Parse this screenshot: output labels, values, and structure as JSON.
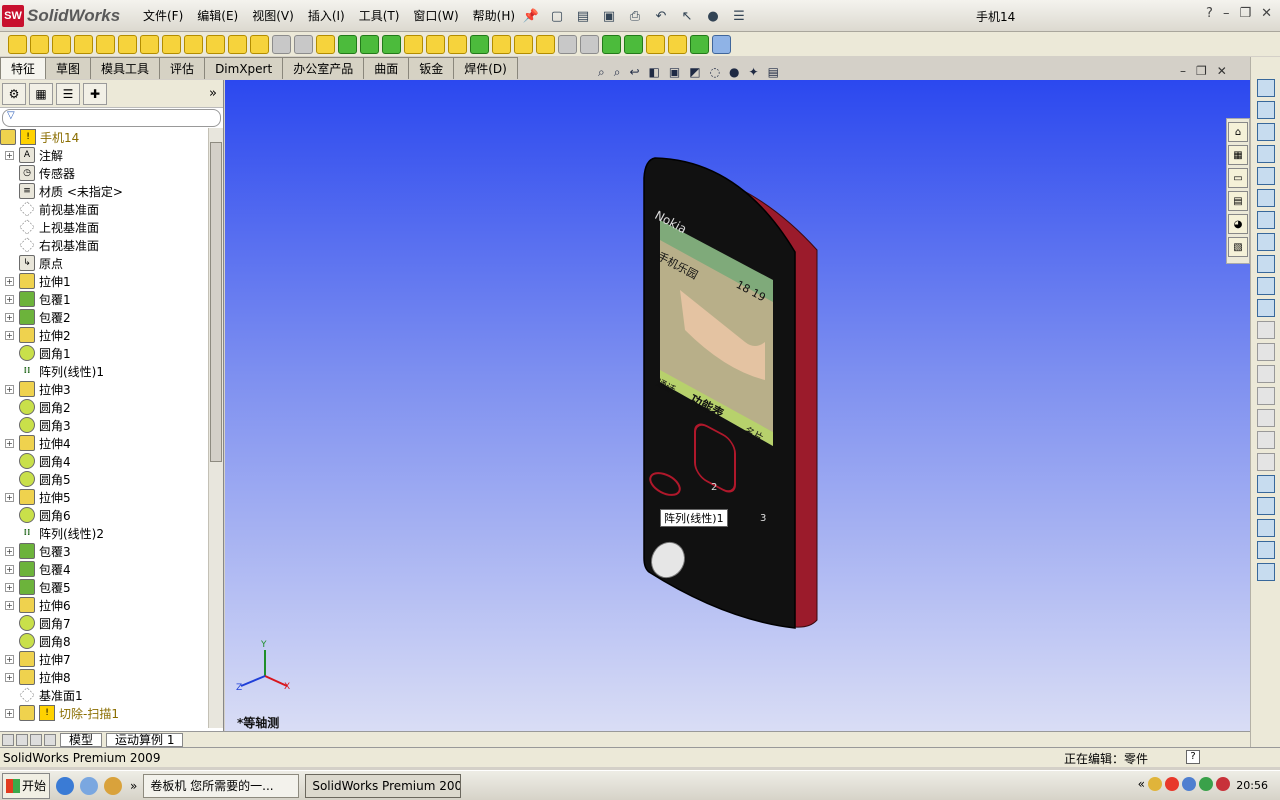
{
  "app": {
    "brand": "SolidWorks",
    "logo_mark": "SW",
    "doc_title": "手机14"
  },
  "menu": [
    "文件(F)",
    "编辑(E)",
    "视图(V)",
    "插入(I)",
    "工具(T)",
    "窗口(W)",
    "帮助(H)"
  ],
  "window_controls": [
    "?",
    "–",
    "❐",
    "✕"
  ],
  "tabs": [
    "特征",
    "草图",
    "模具工具",
    "评估",
    "DimXpert",
    "办公室产品",
    "曲面",
    "钣金",
    "焊件(D)"
  ],
  "active_tab": 0,
  "feature_tree": {
    "filter_placeholder": "",
    "root": {
      "label": "手机14",
      "warning": true
    },
    "items": [
      {
        "label": "注解",
        "icon": "annotation-icon",
        "expandable": true
      },
      {
        "label": "传感器",
        "icon": "sensor-icon",
        "expandable": false
      },
      {
        "label": "材质 <未指定>",
        "icon": "material-icon",
        "expandable": false
      },
      {
        "label": "前视基准面",
        "icon": "plane-icon",
        "expandable": false
      },
      {
        "label": "上视基准面",
        "icon": "plane-icon",
        "expandable": false
      },
      {
        "label": "右视基准面",
        "icon": "plane-icon",
        "expandable": false
      },
      {
        "label": "原点",
        "icon": "origin-icon",
        "expandable": false
      },
      {
        "label": "拉伸1",
        "icon": "extrude-icon",
        "expandable": true
      },
      {
        "label": "包覆1",
        "icon": "wrap-icon",
        "expandable": true
      },
      {
        "label": "包覆2",
        "icon": "wrap-icon",
        "expandable": true
      },
      {
        "label": "拉伸2",
        "icon": "extrude-icon",
        "expandable": true
      },
      {
        "label": "圆角1",
        "icon": "fillet-icon",
        "expandable": false
      },
      {
        "label": "阵列(线性)1",
        "icon": "linear-pattern-icon",
        "expandable": false
      },
      {
        "label": "拉伸3",
        "icon": "extrude-icon",
        "expandable": true
      },
      {
        "label": "圆角2",
        "icon": "fillet-icon",
        "expandable": false
      },
      {
        "label": "圆角3",
        "icon": "fillet-icon",
        "expandable": false
      },
      {
        "label": "拉伸4",
        "icon": "extrude-icon",
        "expandable": true
      },
      {
        "label": "圆角4",
        "icon": "fillet-icon",
        "expandable": false
      },
      {
        "label": "圆角5",
        "icon": "fillet-icon",
        "expandable": false
      },
      {
        "label": "拉伸5",
        "icon": "extrude-icon",
        "expandable": true
      },
      {
        "label": "圆角6",
        "icon": "fillet-icon",
        "expandable": false
      },
      {
        "label": "阵列(线性)2",
        "icon": "linear-pattern-icon",
        "expandable": false
      },
      {
        "label": "包覆3",
        "icon": "wrap-icon",
        "expandable": true
      },
      {
        "label": "包覆4",
        "icon": "wrap-icon",
        "expandable": true
      },
      {
        "label": "包覆5",
        "icon": "wrap-icon",
        "expandable": true
      },
      {
        "label": "拉伸6",
        "icon": "extrude-icon",
        "expandable": true
      },
      {
        "label": "圆角7",
        "icon": "fillet-icon",
        "expandable": false
      },
      {
        "label": "圆角8",
        "icon": "fillet-icon",
        "expandable": false
      },
      {
        "label": "拉伸7",
        "icon": "extrude-icon",
        "expandable": true
      },
      {
        "label": "拉伸8",
        "icon": "extrude-icon",
        "expandable": true
      },
      {
        "label": "基准面1",
        "icon": "plane-icon",
        "expandable": false
      },
      {
        "label": "切除-扫描1",
        "icon": "cut-sweep-icon",
        "expandable": true,
        "warning": true
      }
    ]
  },
  "bottom_tabs": [
    "模型",
    "运动算例 1"
  ],
  "viewport": {
    "view_name": "*等轴测",
    "tooltip": "阵列(线性)1",
    "triad": {
      "x": "X",
      "y": "Y",
      "z": "Z"
    },
    "phone_screen": {
      "brand": "Nokia",
      "header_left": "手机乐园",
      "clock": "18 19",
      "softkey_left": "通话",
      "softkey_center": "功能表",
      "softkey_right": "名片",
      "keys": [
        "2",
        "3"
      ]
    }
  },
  "status": {
    "left": "SolidWorks Premium 2009",
    "editing": "正在编辑：零件",
    "help": "?"
  },
  "taskbar": {
    "start": "开始",
    "tasks": [
      {
        "label": "卷板机 您所需要的一...",
        "active": false
      },
      {
        "label": "SolidWorks Premium 200...",
        "active": true
      }
    ],
    "overflow": "»",
    "tray_overflow": "«",
    "clock": "20:56"
  },
  "colors": {
    "viewport_top": "#2b48ef",
    "viewport_bottom": "#d9ddf5",
    "phone_body": "#111111",
    "phone_edge": "#9b1b2b"
  }
}
